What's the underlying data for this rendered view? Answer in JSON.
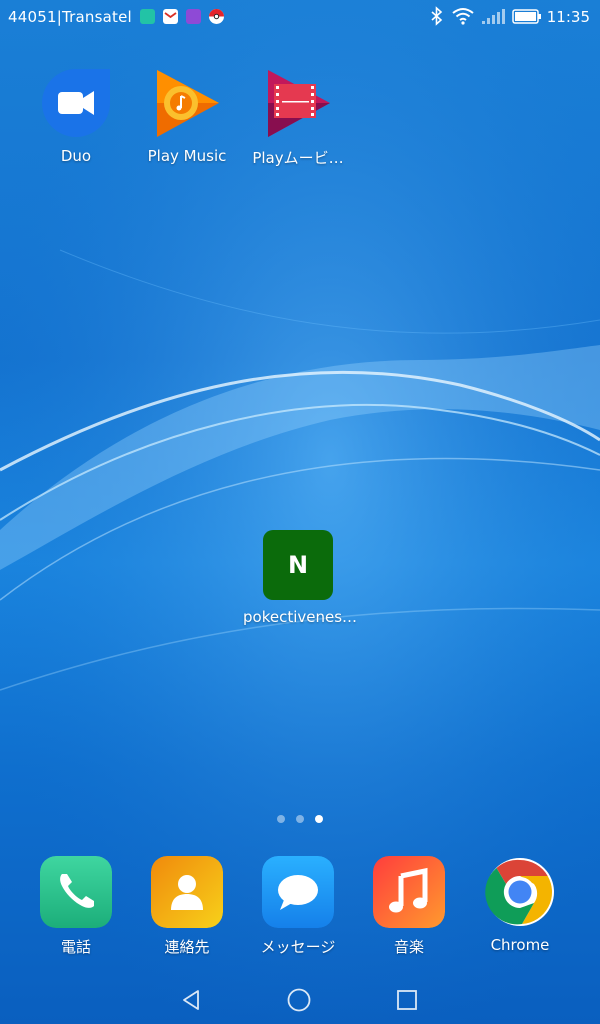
{
  "status_bar": {
    "carrier": "44051|Transatel",
    "time": "11:35",
    "notification_icons": [
      "chat-notification-icon",
      "gmail-icon",
      "gallery-icon",
      "pokeball-icon"
    ],
    "status_icons": [
      "bluetooth-icon",
      "wifi-icon",
      "signal-icon",
      "battery-icon"
    ]
  },
  "home_apps": [
    {
      "label": "Duo",
      "icon": "duo-icon"
    },
    {
      "label": "Play Music",
      "icon": "play-music-icon"
    },
    {
      "label": "Playムービ…",
      "icon": "play-movies-icon"
    },
    {
      "label": "pokectivenes…",
      "icon": "n-app-icon",
      "icon_text": "N"
    }
  ],
  "page_indicator": {
    "count": 3,
    "active": 3
  },
  "dock": [
    {
      "label": "電話",
      "icon": "phone-icon"
    },
    {
      "label": "連絡先",
      "icon": "contacts-icon"
    },
    {
      "label": "メッセージ",
      "icon": "messages-icon"
    },
    {
      "label": "音楽",
      "icon": "music-icon"
    },
    {
      "label": "Chrome",
      "icon": "chrome-icon"
    }
  ],
  "nav_bar": [
    "back-icon",
    "home-icon",
    "recents-icon"
  ],
  "colors": {
    "wallpaper": "#1473d0",
    "n_app": "#0b6b0b",
    "phone": "#2ec78a",
    "contacts": "#f29a0d",
    "messages": "#1e9af5",
    "music": "#ff5a2e"
  }
}
